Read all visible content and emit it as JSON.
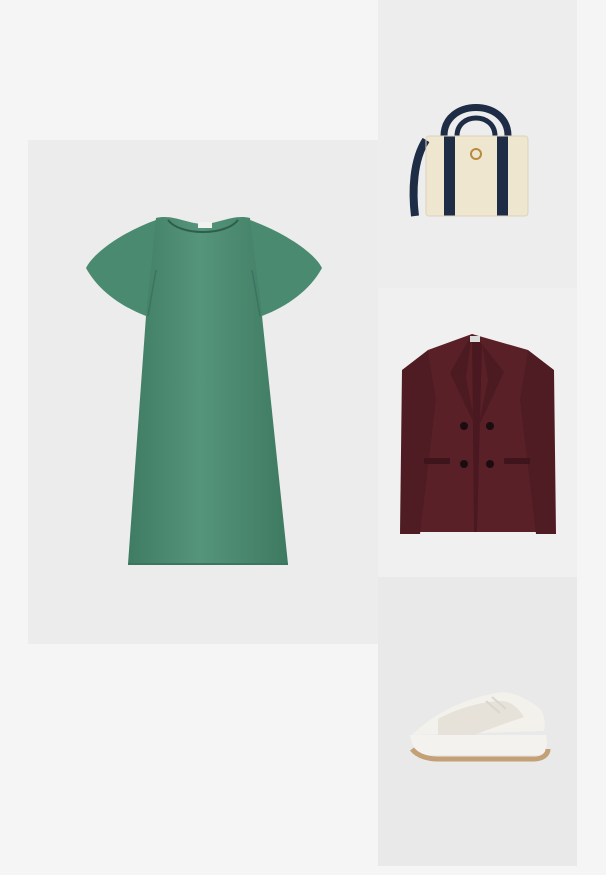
{
  "outfit": {
    "items": [
      {
        "name": "dress",
        "color": "#4f8f76"
      },
      {
        "name": "tote-bag",
        "color": "#efe6cf"
      },
      {
        "name": "blazer",
        "color": "#5a2028"
      },
      {
        "name": "sneaker",
        "color": "#f3f1ec"
      }
    ]
  }
}
